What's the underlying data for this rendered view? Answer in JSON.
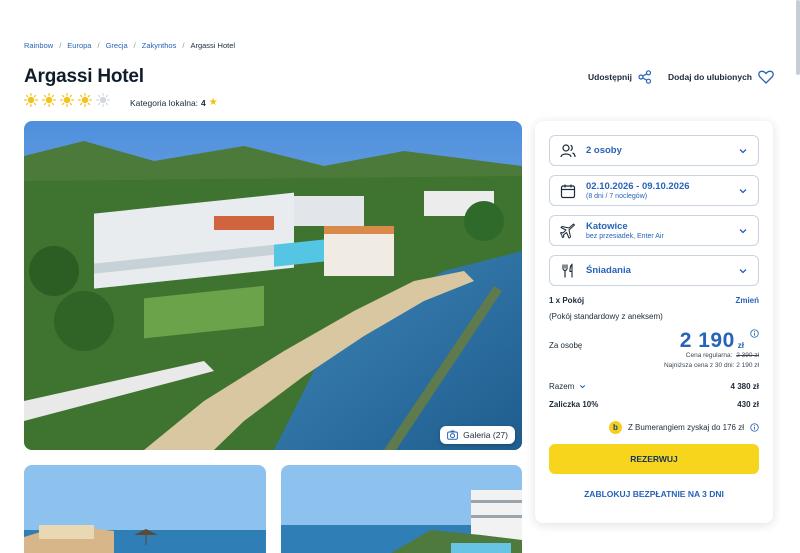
{
  "breadcrumb": {
    "items": [
      "Rainbow",
      "Europa",
      "Grecja",
      "Zakynthos"
    ],
    "current": "Argassi Hotel"
  },
  "hotel": {
    "title": "Argassi Hotel",
    "sun_rating": 4,
    "sun_rating_max": 5,
    "local_category_label": "Kategoria lokalna:",
    "local_category_value": "4"
  },
  "actions": {
    "share_label": "Udostępnij",
    "favorite_label": "Dodaj do ulubionych"
  },
  "gallery": {
    "button_label": "Galeria (27)"
  },
  "booking": {
    "persons": "2 osoby",
    "dates": "02.10.2026 - 09.10.2026",
    "dates_sub": "(8 dni / 7 noclegów)",
    "departure": "Katowice",
    "departure_sub": "bez przesiadek, Enter Air",
    "board": "Śniadania",
    "room_line": "1 x Pokój",
    "change_label": "Zmień",
    "room_type": "(Pokój standardowy z aneksem)",
    "per_person_label": "Za osobę",
    "price_amount": "2 190",
    "price_currency": "zł",
    "regular_price_label": "Cena regularna:",
    "regular_price_value": "2 390 zł",
    "lowest_price": "Najniższa cena z 30 dni: 2 190 zł",
    "total_label": "Razem",
    "total_value": "4 380 zł",
    "deposit_label": "Zaliczka 10%",
    "deposit_value": "430 zł",
    "bumerang_text": "Z Bumerangiem zyskaj do 176 zł",
    "book_button": "REZERWUJ",
    "block_button": "ZABLOKUJ BEZPŁATNIE NA 3 DNI"
  },
  "colors": {
    "accent_blue": "#2763b8",
    "book_yellow": "#f7d51d",
    "sun_yellow": "#f3c21b"
  }
}
